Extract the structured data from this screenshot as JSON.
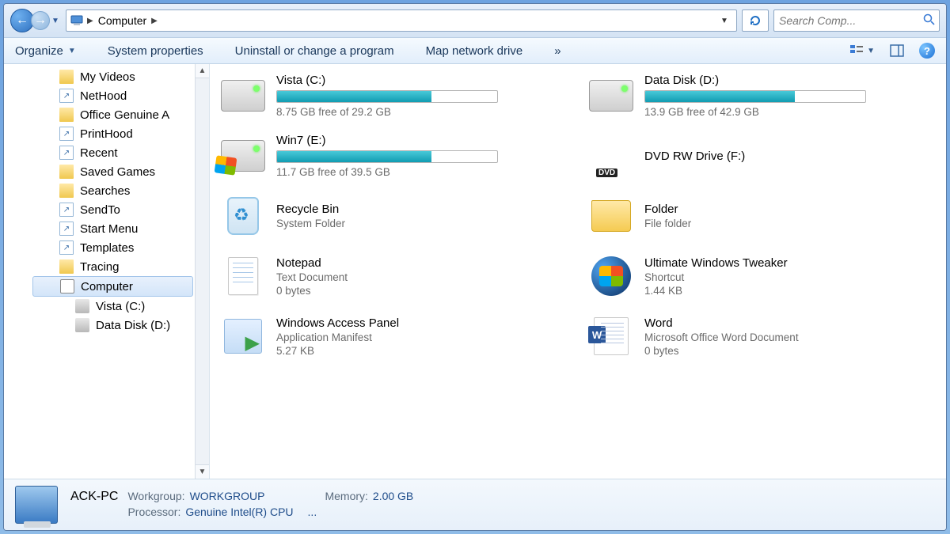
{
  "breadcrumb": {
    "location": "Computer"
  },
  "search": {
    "placeholder": "Search Comp..."
  },
  "toolbar": {
    "organize": "Organize",
    "system_properties": "System properties",
    "uninstall": "Uninstall or change a program",
    "map_drive": "Map network drive",
    "overflow": "»"
  },
  "nav": {
    "items": [
      {
        "label": "My Videos",
        "icon": "folder"
      },
      {
        "label": "NetHood",
        "icon": "file"
      },
      {
        "label": "Office Genuine A",
        "icon": "folder"
      },
      {
        "label": "PrintHood",
        "icon": "file"
      },
      {
        "label": "Recent",
        "icon": "file"
      },
      {
        "label": "Saved Games",
        "icon": "folder"
      },
      {
        "label": "Searches",
        "icon": "folder"
      },
      {
        "label": "SendTo",
        "icon": "file"
      },
      {
        "label": "Start Menu",
        "icon": "file"
      },
      {
        "label": "Templates",
        "icon": "file"
      },
      {
        "label": "Tracing",
        "icon": "folder"
      }
    ],
    "computer": "Computer",
    "drives": [
      {
        "label": "Vista (C:)"
      },
      {
        "label": "Data Disk (D:)"
      }
    ]
  },
  "tiles": {
    "vista": {
      "title": "Vista (C:)",
      "sub": "8.75 GB free of 29.2 GB",
      "fill": 70
    },
    "data": {
      "title": "Data Disk (D:)",
      "sub": "13.9 GB free of 42.9 GB",
      "fill": 68
    },
    "win7": {
      "title": "Win7 (E:)",
      "sub": "11.7 GB free of 39.5 GB",
      "fill": 70
    },
    "dvd": {
      "title": "DVD RW Drive (F:)"
    },
    "bin": {
      "title": "Recycle Bin",
      "sub": "System Folder"
    },
    "folder": {
      "title": "Folder",
      "sub": "File folder"
    },
    "notepad": {
      "title": "Notepad",
      "sub1": "Text Document",
      "sub2": "0 bytes"
    },
    "uwt": {
      "title": "Ultimate Windows  Tweaker",
      "sub1": "Shortcut",
      "sub2": "1.44 KB"
    },
    "wap": {
      "title": "Windows Access Panel",
      "sub1": "Application Manifest",
      "sub2": "5.27 KB"
    },
    "word": {
      "title": "Word",
      "sub1": "Microsoft Office Word Document",
      "sub2": "0 bytes"
    }
  },
  "details": {
    "name": "ACK-PC",
    "workgroup_lbl": "Workgroup:",
    "workgroup_val": "WORKGROUP",
    "memory_lbl": "Memory:",
    "memory_val": "2.00 GB",
    "processor_lbl": "Processor:",
    "processor_val": "Genuine Intel(R) CPU",
    "ellipsis": "..."
  }
}
